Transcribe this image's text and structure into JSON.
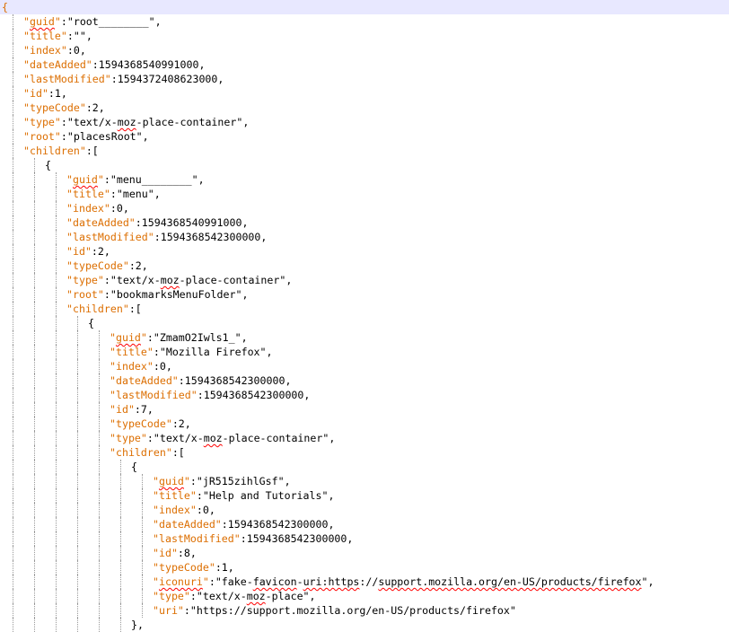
{
  "editor": {
    "colors": {
      "key": "#dc6e00",
      "text": "#000000",
      "current_line": "#e8e8ff",
      "indent_guide": "#9a9a9a",
      "spell_squiggle": "#ff0000"
    },
    "lines": [
      {
        "depth": 0,
        "tokens": [
          {
            "t": "{",
            "c": "k"
          }
        ]
      },
      {
        "depth": 1,
        "tokens": [
          {
            "t": "\"",
            "c": "k"
          },
          {
            "t": "guid",
            "c": "k",
            "sq": true
          },
          {
            "t": "\"",
            "c": "k"
          },
          {
            "t": ":\"root________\",",
            "c": "v"
          }
        ]
      },
      {
        "depth": 1,
        "tokens": [
          {
            "t": "\"title\"",
            "c": "k"
          },
          {
            "t": ":\"\",",
            "c": "v"
          }
        ]
      },
      {
        "depth": 1,
        "tokens": [
          {
            "t": "\"index\"",
            "c": "k"
          },
          {
            "t": ":0,",
            "c": "v"
          }
        ]
      },
      {
        "depth": 1,
        "tokens": [
          {
            "t": "\"dateAdded\"",
            "c": "k"
          },
          {
            "t": ":1594368540991000,",
            "c": "v"
          }
        ]
      },
      {
        "depth": 1,
        "tokens": [
          {
            "t": "\"lastModified\"",
            "c": "k"
          },
          {
            "t": ":1594372408623000,",
            "c": "v"
          }
        ]
      },
      {
        "depth": 1,
        "tokens": [
          {
            "t": "\"id\"",
            "c": "k"
          },
          {
            "t": ":1,",
            "c": "v"
          }
        ]
      },
      {
        "depth": 1,
        "tokens": [
          {
            "t": "\"typeCode\"",
            "c": "k"
          },
          {
            "t": ":2,",
            "c": "v"
          }
        ]
      },
      {
        "depth": 1,
        "tokens": [
          {
            "t": "\"type\"",
            "c": "k"
          },
          {
            "t": ":\"text/x-",
            "c": "v"
          },
          {
            "t": "moz",
            "c": "v",
            "sq": true
          },
          {
            "t": "-place-container\",",
            "c": "v"
          }
        ]
      },
      {
        "depth": 1,
        "tokens": [
          {
            "t": "\"root\"",
            "c": "k"
          },
          {
            "t": ":\"placesRoot\",",
            "c": "v"
          }
        ]
      },
      {
        "depth": 1,
        "tokens": [
          {
            "t": "\"children\"",
            "c": "k"
          },
          {
            "t": ":[",
            "c": "v"
          }
        ]
      },
      {
        "depth": 2,
        "tokens": [
          {
            "t": "{",
            "c": "p"
          }
        ]
      },
      {
        "depth": 3,
        "tokens": [
          {
            "t": "\"",
            "c": "k"
          },
          {
            "t": "guid",
            "c": "k",
            "sq": true
          },
          {
            "t": "\"",
            "c": "k"
          },
          {
            "t": ":\"menu________\",",
            "c": "v"
          }
        ]
      },
      {
        "depth": 3,
        "tokens": [
          {
            "t": "\"title\"",
            "c": "k"
          },
          {
            "t": ":\"menu\",",
            "c": "v"
          }
        ]
      },
      {
        "depth": 3,
        "tokens": [
          {
            "t": "\"index\"",
            "c": "k"
          },
          {
            "t": ":0,",
            "c": "v"
          }
        ]
      },
      {
        "depth": 3,
        "tokens": [
          {
            "t": "\"dateAdded\"",
            "c": "k"
          },
          {
            "t": ":1594368540991000,",
            "c": "v"
          }
        ]
      },
      {
        "depth": 3,
        "tokens": [
          {
            "t": "\"lastModified\"",
            "c": "k"
          },
          {
            "t": ":1594368542300000,",
            "c": "v"
          }
        ]
      },
      {
        "depth": 3,
        "tokens": [
          {
            "t": "\"id\"",
            "c": "k"
          },
          {
            "t": ":2,",
            "c": "v"
          }
        ]
      },
      {
        "depth": 3,
        "tokens": [
          {
            "t": "\"typeCode\"",
            "c": "k"
          },
          {
            "t": ":2,",
            "c": "v"
          }
        ]
      },
      {
        "depth": 3,
        "tokens": [
          {
            "t": "\"type\"",
            "c": "k"
          },
          {
            "t": ":\"text/x-",
            "c": "v"
          },
          {
            "t": "moz",
            "c": "v",
            "sq": true
          },
          {
            "t": "-place-container\",",
            "c": "v"
          }
        ]
      },
      {
        "depth": 3,
        "tokens": [
          {
            "t": "\"root\"",
            "c": "k"
          },
          {
            "t": ":\"bookmarksMenuFolder\",",
            "c": "v"
          }
        ]
      },
      {
        "depth": 3,
        "tokens": [
          {
            "t": "\"children\"",
            "c": "k"
          },
          {
            "t": ":[",
            "c": "v"
          }
        ]
      },
      {
        "depth": 4,
        "tokens": [
          {
            "t": "{",
            "c": "p"
          }
        ]
      },
      {
        "depth": 5,
        "tokens": [
          {
            "t": "\"",
            "c": "k"
          },
          {
            "t": "guid",
            "c": "k",
            "sq": true
          },
          {
            "t": "\"",
            "c": "k"
          },
          {
            "t": ":\"ZmamO2Iwls1_\",",
            "c": "v"
          }
        ]
      },
      {
        "depth": 5,
        "tokens": [
          {
            "t": "\"title\"",
            "c": "k"
          },
          {
            "t": ":\"Mozilla Firefox\",",
            "c": "v"
          }
        ]
      },
      {
        "depth": 5,
        "tokens": [
          {
            "t": "\"index\"",
            "c": "k"
          },
          {
            "t": ":0,",
            "c": "v"
          }
        ]
      },
      {
        "depth": 5,
        "tokens": [
          {
            "t": "\"dateAdded\"",
            "c": "k"
          },
          {
            "t": ":1594368542300000,",
            "c": "v"
          }
        ]
      },
      {
        "depth": 5,
        "tokens": [
          {
            "t": "\"lastModified\"",
            "c": "k"
          },
          {
            "t": ":1594368542300000,",
            "c": "v"
          }
        ]
      },
      {
        "depth": 5,
        "tokens": [
          {
            "t": "\"id\"",
            "c": "k"
          },
          {
            "t": ":7,",
            "c": "v"
          }
        ]
      },
      {
        "depth": 5,
        "tokens": [
          {
            "t": "\"typeCode\"",
            "c": "k"
          },
          {
            "t": ":2,",
            "c": "v"
          }
        ]
      },
      {
        "depth": 5,
        "tokens": [
          {
            "t": "\"type\"",
            "c": "k"
          },
          {
            "t": ":\"text/x-",
            "c": "v"
          },
          {
            "t": "moz",
            "c": "v",
            "sq": true
          },
          {
            "t": "-place-container\",",
            "c": "v"
          }
        ]
      },
      {
        "depth": 5,
        "tokens": [
          {
            "t": "\"children\"",
            "c": "k"
          },
          {
            "t": ":[",
            "c": "v"
          }
        ]
      },
      {
        "depth": 6,
        "tokens": [
          {
            "t": "{",
            "c": "p"
          }
        ]
      },
      {
        "depth": 7,
        "tokens": [
          {
            "t": "\"",
            "c": "k"
          },
          {
            "t": "guid",
            "c": "k",
            "sq": true
          },
          {
            "t": "\"",
            "c": "k"
          },
          {
            "t": ":\"jR515zihlGsf\",",
            "c": "v"
          }
        ]
      },
      {
        "depth": 7,
        "tokens": [
          {
            "t": "\"title\"",
            "c": "k"
          },
          {
            "t": ":\"Help and Tutorials\",",
            "c": "v"
          }
        ]
      },
      {
        "depth": 7,
        "tokens": [
          {
            "t": "\"index\"",
            "c": "k"
          },
          {
            "t": ":0,",
            "c": "v"
          }
        ]
      },
      {
        "depth": 7,
        "tokens": [
          {
            "t": "\"dateAdded\"",
            "c": "k"
          },
          {
            "t": ":1594368542300000,",
            "c": "v"
          }
        ]
      },
      {
        "depth": 7,
        "tokens": [
          {
            "t": "\"lastModified\"",
            "c": "k"
          },
          {
            "t": ":1594368542300000,",
            "c": "v"
          }
        ]
      },
      {
        "depth": 7,
        "tokens": [
          {
            "t": "\"id\"",
            "c": "k"
          },
          {
            "t": ":8,",
            "c": "v"
          }
        ]
      },
      {
        "depth": 7,
        "tokens": [
          {
            "t": "\"typeCode\"",
            "c": "k"
          },
          {
            "t": ":1,",
            "c": "v"
          }
        ]
      },
      {
        "depth": 7,
        "tokens": [
          {
            "t": "\"",
            "c": "k"
          },
          {
            "t": "iconuri",
            "c": "k",
            "sq": true
          },
          {
            "t": "\"",
            "c": "k"
          },
          {
            "t": ":\"fake-",
            "c": "v"
          },
          {
            "t": "favicon",
            "c": "v",
            "sq": true
          },
          {
            "t": "-",
            "c": "v"
          },
          {
            "t": "uri:https",
            "c": "v",
            "sq": true
          },
          {
            "t": "://",
            "c": "v"
          },
          {
            "t": "support.mozilla.org/en-US/products/firefox",
            "c": "v",
            "sq": true
          },
          {
            "t": "\",",
            "c": "v"
          }
        ]
      },
      {
        "depth": 7,
        "tokens": [
          {
            "t": "\"type\"",
            "c": "k"
          },
          {
            "t": ":\"text/x-",
            "c": "v"
          },
          {
            "t": "moz",
            "c": "v",
            "sq": true
          },
          {
            "t": "-place\",",
            "c": "v"
          }
        ]
      },
      {
        "depth": 7,
        "tokens": [
          {
            "t": "\"uri\"",
            "c": "k"
          },
          {
            "t": ":\"https://support.mozilla.org/en-US/products/firefox\"",
            "c": "v"
          }
        ]
      },
      {
        "depth": 6,
        "tokens": [
          {
            "t": "},",
            "c": "p"
          }
        ]
      }
    ]
  }
}
